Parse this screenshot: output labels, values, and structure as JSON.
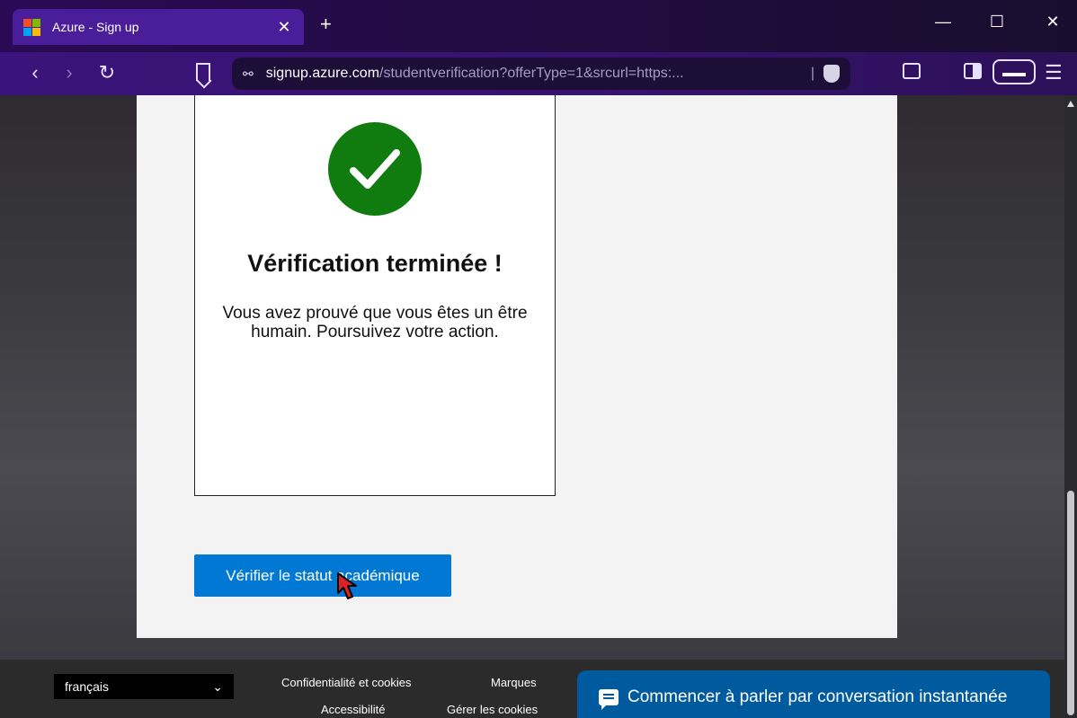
{
  "browser": {
    "tab_title": "Azure - Sign up",
    "tab_close": "✕",
    "new_tab": "+",
    "url_host": "signup.azure.com",
    "url_path": "/studentverification?offerType=1&srcurl=https:...",
    "window_controls": {
      "minimize": "—",
      "maximize": "☐",
      "close": "✕"
    },
    "nav": {
      "back": "‹",
      "forward": "›",
      "reload": "↻"
    },
    "menu_icon": "☰",
    "icons": [
      "microsoft-logo-icon",
      "bookmark-icon",
      "site-settings-icon",
      "brave-shields-icon",
      "reader-mode-icon",
      "sidebar-icon",
      "private-glasses-icon",
      "menu-icon"
    ]
  },
  "verification": {
    "title": "Vérification terminée !",
    "message": "Vous avez prouvé que vous êtes un être humain. Poursuivez votre action.",
    "status_color": "#107c10"
  },
  "main": {
    "verify_button": "Vérifier le statut académique",
    "accent_color": "#0078d4"
  },
  "footer": {
    "language": "français",
    "links": {
      "privacy": "Confidentialité et cookies",
      "trademarks": "Marques",
      "accessibility": "Accessibilité",
      "manage_cookies": "Gérer les cookies"
    },
    "chat_button": "Commencer à parler par conversation instantanée"
  }
}
